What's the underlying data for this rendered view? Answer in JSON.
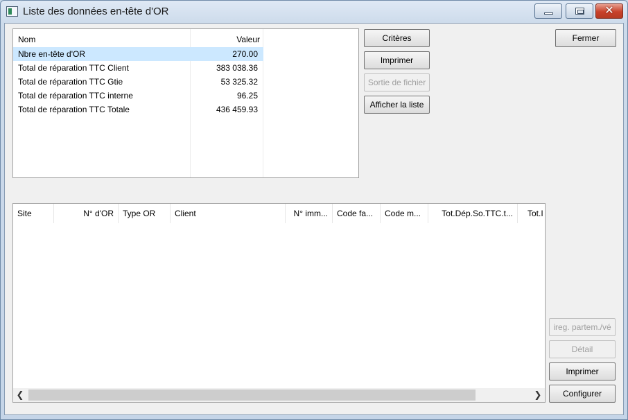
{
  "window": {
    "title": "Liste des données en-tête d'OR",
    "close_glyph": "✕"
  },
  "summary": {
    "headers": {
      "name": "Nom",
      "value": "Valeur"
    },
    "rows": [
      {
        "name": "Nbre en-tête d'OR",
        "value": "270.00",
        "selected": true
      },
      {
        "name": "Total de réparation TTC Client",
        "value": "383 038.36"
      },
      {
        "name": "Total de réparation TTC Gtie",
        "value": "53 325.32"
      },
      {
        "name": "Total de réparation TTC interne",
        "value": "96.25"
      },
      {
        "name": "Total de réparation TTC Totale",
        "value": "436 459.93"
      }
    ]
  },
  "buttons": {
    "criteria": "Critères",
    "print_top": "Imprimer",
    "file_output": "Sortie de fichier",
    "show_list": "Afficher la liste",
    "close": "Fermer",
    "reg_partner": "ireg. partem./vé",
    "detail": "Détail",
    "print_bottom": "Imprimer",
    "configure": "Configurer"
  },
  "grid": {
    "columns": [
      "Site",
      "N° d'OR",
      "Type OR",
      "Client",
      "N° imm...",
      "Code fa...",
      "Code m...",
      "Tot.Dép.So.TTC.t...",
      "Tot.I"
    ],
    "rows": []
  },
  "scrollbar": {
    "left_arrow": "❮",
    "right_arrow": "❯"
  },
  "colors": {
    "selection": "#cce8ff",
    "close_button": "#c8412a",
    "disabled_text": "#a0a0a0"
  }
}
